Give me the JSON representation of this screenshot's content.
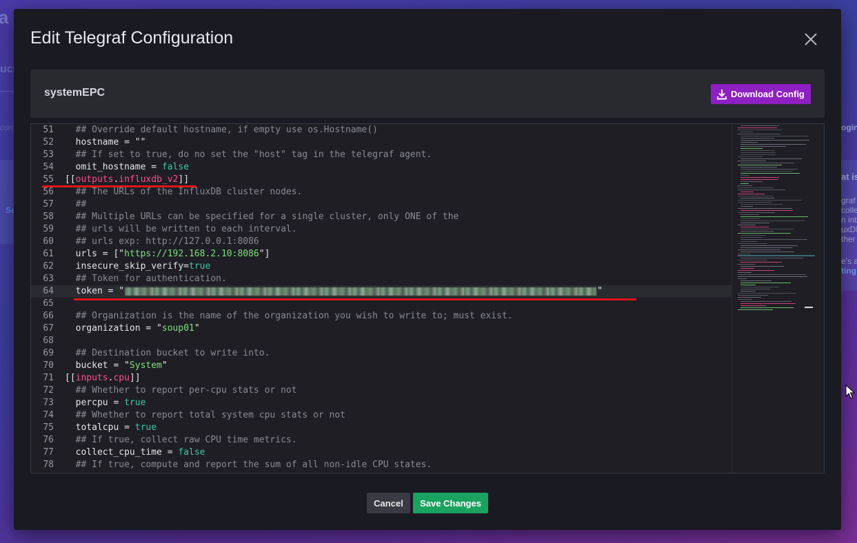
{
  "background": {
    "fragments": {
      "a": "a",
      "uc": "uck",
      "con": "con",
      "se": "Se",
      "login": "ogin"
    },
    "right_text": {
      "heading": "at is",
      "lines": [
        "graf",
        "colle",
        "n int",
        "uxDB",
        "ther"
      ],
      "line_a": "e's a",
      "link": "ting"
    }
  },
  "modal": {
    "title": "Edit Telegraf Configuration",
    "close_icon": "close-icon",
    "config_name": "systemEPC",
    "download_label": "Download Config",
    "cancel_label": "Cancel",
    "save_label": "Save Changes"
  },
  "editor": {
    "lines": [
      {
        "n": "51",
        "t": "  ## Override default hostname, if empty use os.Hostname()"
      },
      {
        "n": "52",
        "t": "  hostname = \"\""
      },
      {
        "n": "53",
        "t": "  ## If set to true, do no set the \"host\" tag in the telegraf agent."
      },
      {
        "n": "54",
        "t": "  omit_hostname = false"
      },
      {
        "n": "55",
        "t": "[[outputs.influxdb_v2]]"
      },
      {
        "n": "56",
        "t": "  ## The URLs of the InfluxDB cluster nodes."
      },
      {
        "n": "57",
        "t": "  ##"
      },
      {
        "n": "58",
        "t": "  ## Multiple URLs can be specified for a single cluster, only ONE of the"
      },
      {
        "n": "59",
        "t": "  ## urls will be written to each interval."
      },
      {
        "n": "60",
        "t": "  ## urls exp: http://127.0.0.1:8086"
      },
      {
        "n": "61",
        "t": "  urls = [\"https://192.168.2.10:8086\"]"
      },
      {
        "n": "62",
        "t": "  insecure_skip_verify=true"
      },
      {
        "n": "63",
        "t": "  ## Token for authentication."
      },
      {
        "n": "64",
        "t": "  token = \"\""
      },
      {
        "n": "65",
        "t": ""
      },
      {
        "n": "66",
        "t": "  ## Organization is the name of the organization you wish to write to; must exist."
      },
      {
        "n": "67",
        "t": "  organization = \"soup01\""
      },
      {
        "n": "68",
        "t": ""
      },
      {
        "n": "69",
        "t": "  ## Destination bucket to write into."
      },
      {
        "n": "70",
        "t": "  bucket = \"System\""
      },
      {
        "n": "71",
        "t": "[[inputs.cpu]]"
      },
      {
        "n": "72",
        "t": "  ## Whether to report per-cpu stats or not"
      },
      {
        "n": "73",
        "t": "  percpu = true"
      },
      {
        "n": "74",
        "t": "  ## Whether to report total system cpu stats or not"
      },
      {
        "n": "75",
        "t": "  totalcpu = true"
      },
      {
        "n": "76",
        "t": "  ## If true, collect raw CPU time metrics."
      },
      {
        "n": "77",
        "t": "  collect_cpu_time = false"
      },
      {
        "n": "78",
        "t": "  ## If true, compute and report the sum of all non-idle CPU states."
      }
    ]
  },
  "colors": {
    "modal_bg": "#1a1a22",
    "download": "#8e1fc3",
    "save": "#1aa25f",
    "cancel": "#3a3a44",
    "comment": "#8a8a94",
    "string": "#7ee07e",
    "boolean": "#3ec9a7",
    "section": "#ff4f8a",
    "annotation": "#e0141e"
  }
}
